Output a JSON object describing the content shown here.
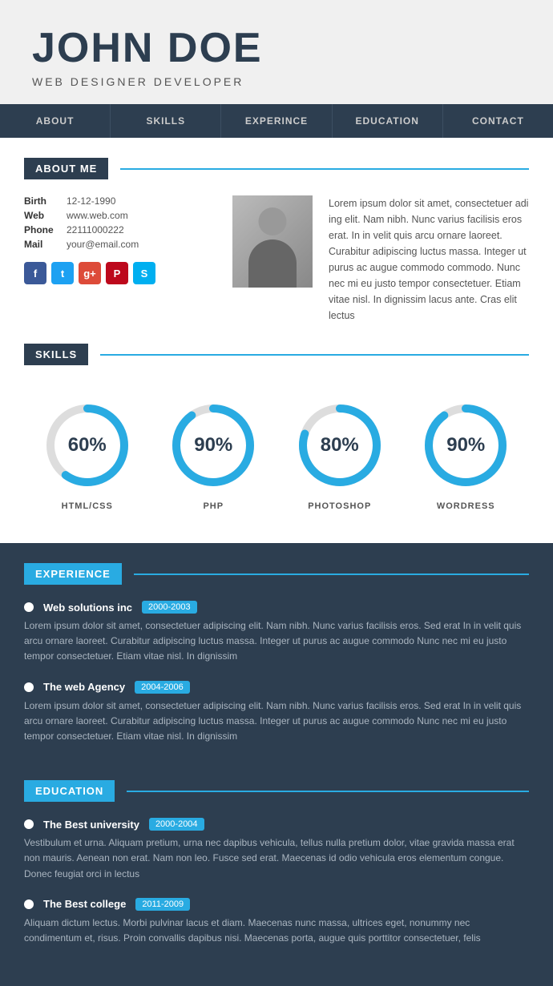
{
  "header": {
    "name": "JOHN DOE",
    "title": "WEB DESIGNER DEVELOPER"
  },
  "nav": {
    "items": [
      "ABOUT",
      "SKILLS",
      "EXPERINCE",
      "EDUCATION",
      "CONTACT"
    ]
  },
  "about": {
    "section_label": "ABOUT ME",
    "birth": "12-12-1990",
    "web": "www.web.com",
    "phone": "22111000222",
    "mail": "your@email.com",
    "bio": "Lorem ipsum dolor sit amet, consectetuer adi ing elit. Nam nibh. Nunc varius facilisis eros erat. In in velit quis arcu ornare laoreet. Curabitur adipiscing luctus massa. Integer ut purus ac augue commodo commodo. Nunc nec mi eu justo tempor consectetuer. Etiam vitae nisl. In dignissim lacus ante. Cras elit lectus"
  },
  "skills": {
    "section_label": "SKILLS",
    "items": [
      {
        "name": "HTML/CSS",
        "percent": 60
      },
      {
        "name": "PHP",
        "percent": 90
      },
      {
        "name": "PHOTOSHOP",
        "percent": 80
      },
      {
        "name": "WORDRESS",
        "percent": 90
      }
    ]
  },
  "experience": {
    "section_label": "EXPERIENCE",
    "items": [
      {
        "company": "Web solutions inc",
        "years": "2000-2003",
        "desc": "Lorem ipsum dolor sit amet, consectetuer adipiscing elit. Nam nibh. Nunc varius facilisis eros. Sed erat In in velit quis arcu ornare laoreet. Curabitur adipiscing luctus massa. Integer ut purus ac augue commodo Nunc nec mi eu justo tempor consectetuer. Etiam vitae nisl. In dignissim"
      },
      {
        "company": "The web Agency",
        "years": "2004-2006",
        "desc": "Lorem ipsum dolor sit amet, consectetuer adipiscing elit. Nam nibh. Nunc varius facilisis eros. Sed erat In in velit quis arcu ornare laoreet. Curabitur adipiscing luctus massa. Integer ut purus ac augue commodo Nunc nec mi eu justo tempor consectetuer. Etiam vitae nisl. In dignissim"
      }
    ]
  },
  "education": {
    "section_label": "EDUCATION",
    "items": [
      {
        "school": "The Best university",
        "years": "2000-2004",
        "desc": "Vestibulum et urna. Aliquam pretium, urna nec dapibus vehicula, tellus nulla pretium dolor, vitae gravida massa erat non mauris. Aenean non erat. Nam non leo. Fusce sed erat. Maecenas id odio vehicula eros elementum congue. Donec feugiat orci in lectus"
      },
      {
        "school": "The Best college",
        "years": "2011-2009",
        "desc": "Aliquam dictum lectus. Morbi pulvinar lacus et diam. Maecenas nunc massa, ultrices eget, nonummy nec condimentum et, risus. Proin convallis dapibus nisi. Maecenas porta, augue quis porttitor consectetuer, felis"
      }
    ]
  },
  "colors": {
    "dark_bg": "#2d3e50",
    "blue_accent": "#29abe2",
    "donut_bg": "#ddd",
    "donut_fill": "#29abe2"
  }
}
